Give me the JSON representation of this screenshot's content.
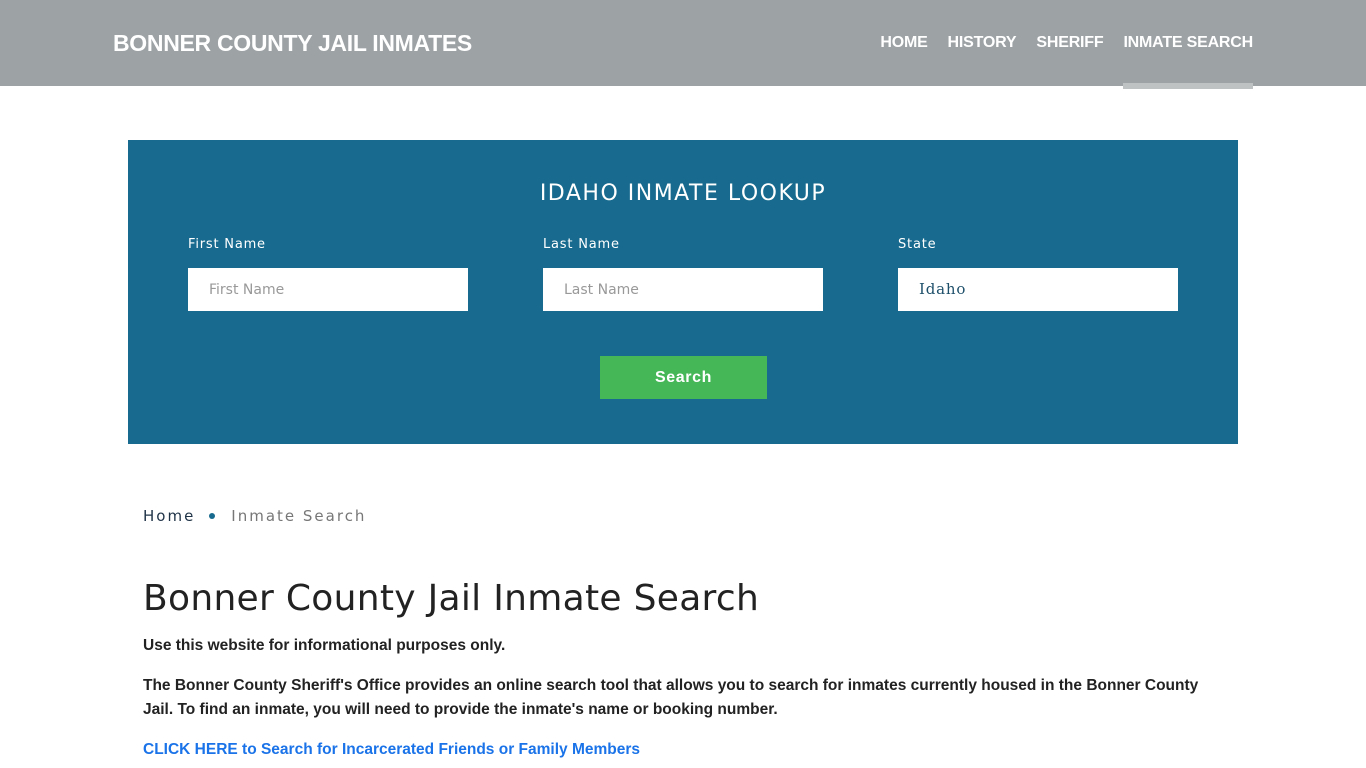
{
  "header": {
    "brand": "BONNER COUNTY JAIL INMATES",
    "nav": [
      {
        "label": "HOME",
        "active": false
      },
      {
        "label": "HISTORY",
        "active": false
      },
      {
        "label": "SHERIFF",
        "active": false
      },
      {
        "label": "INMATE SEARCH",
        "active": true
      }
    ]
  },
  "lookup": {
    "title": "IDAHO INMATE LOOKUP",
    "first_name": {
      "label": "First Name",
      "placeholder": "First Name",
      "value": ""
    },
    "last_name": {
      "label": "Last Name",
      "placeholder": "Last Name",
      "value": ""
    },
    "state": {
      "label": "State",
      "value": "Idaho"
    },
    "search_label": "Search"
  },
  "breadcrumb": {
    "home": "Home",
    "current": "Inmate Search"
  },
  "content": {
    "title": "Bonner County Jail Inmate Search",
    "para1": "Use this website for informational purposes only.",
    "para2": "The Bonner County Sheriff's Office provides an online search tool that allows you to search for inmates currently housed in the Bonner County Jail. To find an inmate, you will need to provide the inmate's name or booking number.",
    "cta": "CLICK HERE to Search for Incarcerated Friends or Family Members"
  },
  "colors": {
    "header_bg": "#9da2a5",
    "lookup_bg": "#186b8e",
    "search_button": "#45b757",
    "link": "#1a73e8"
  }
}
